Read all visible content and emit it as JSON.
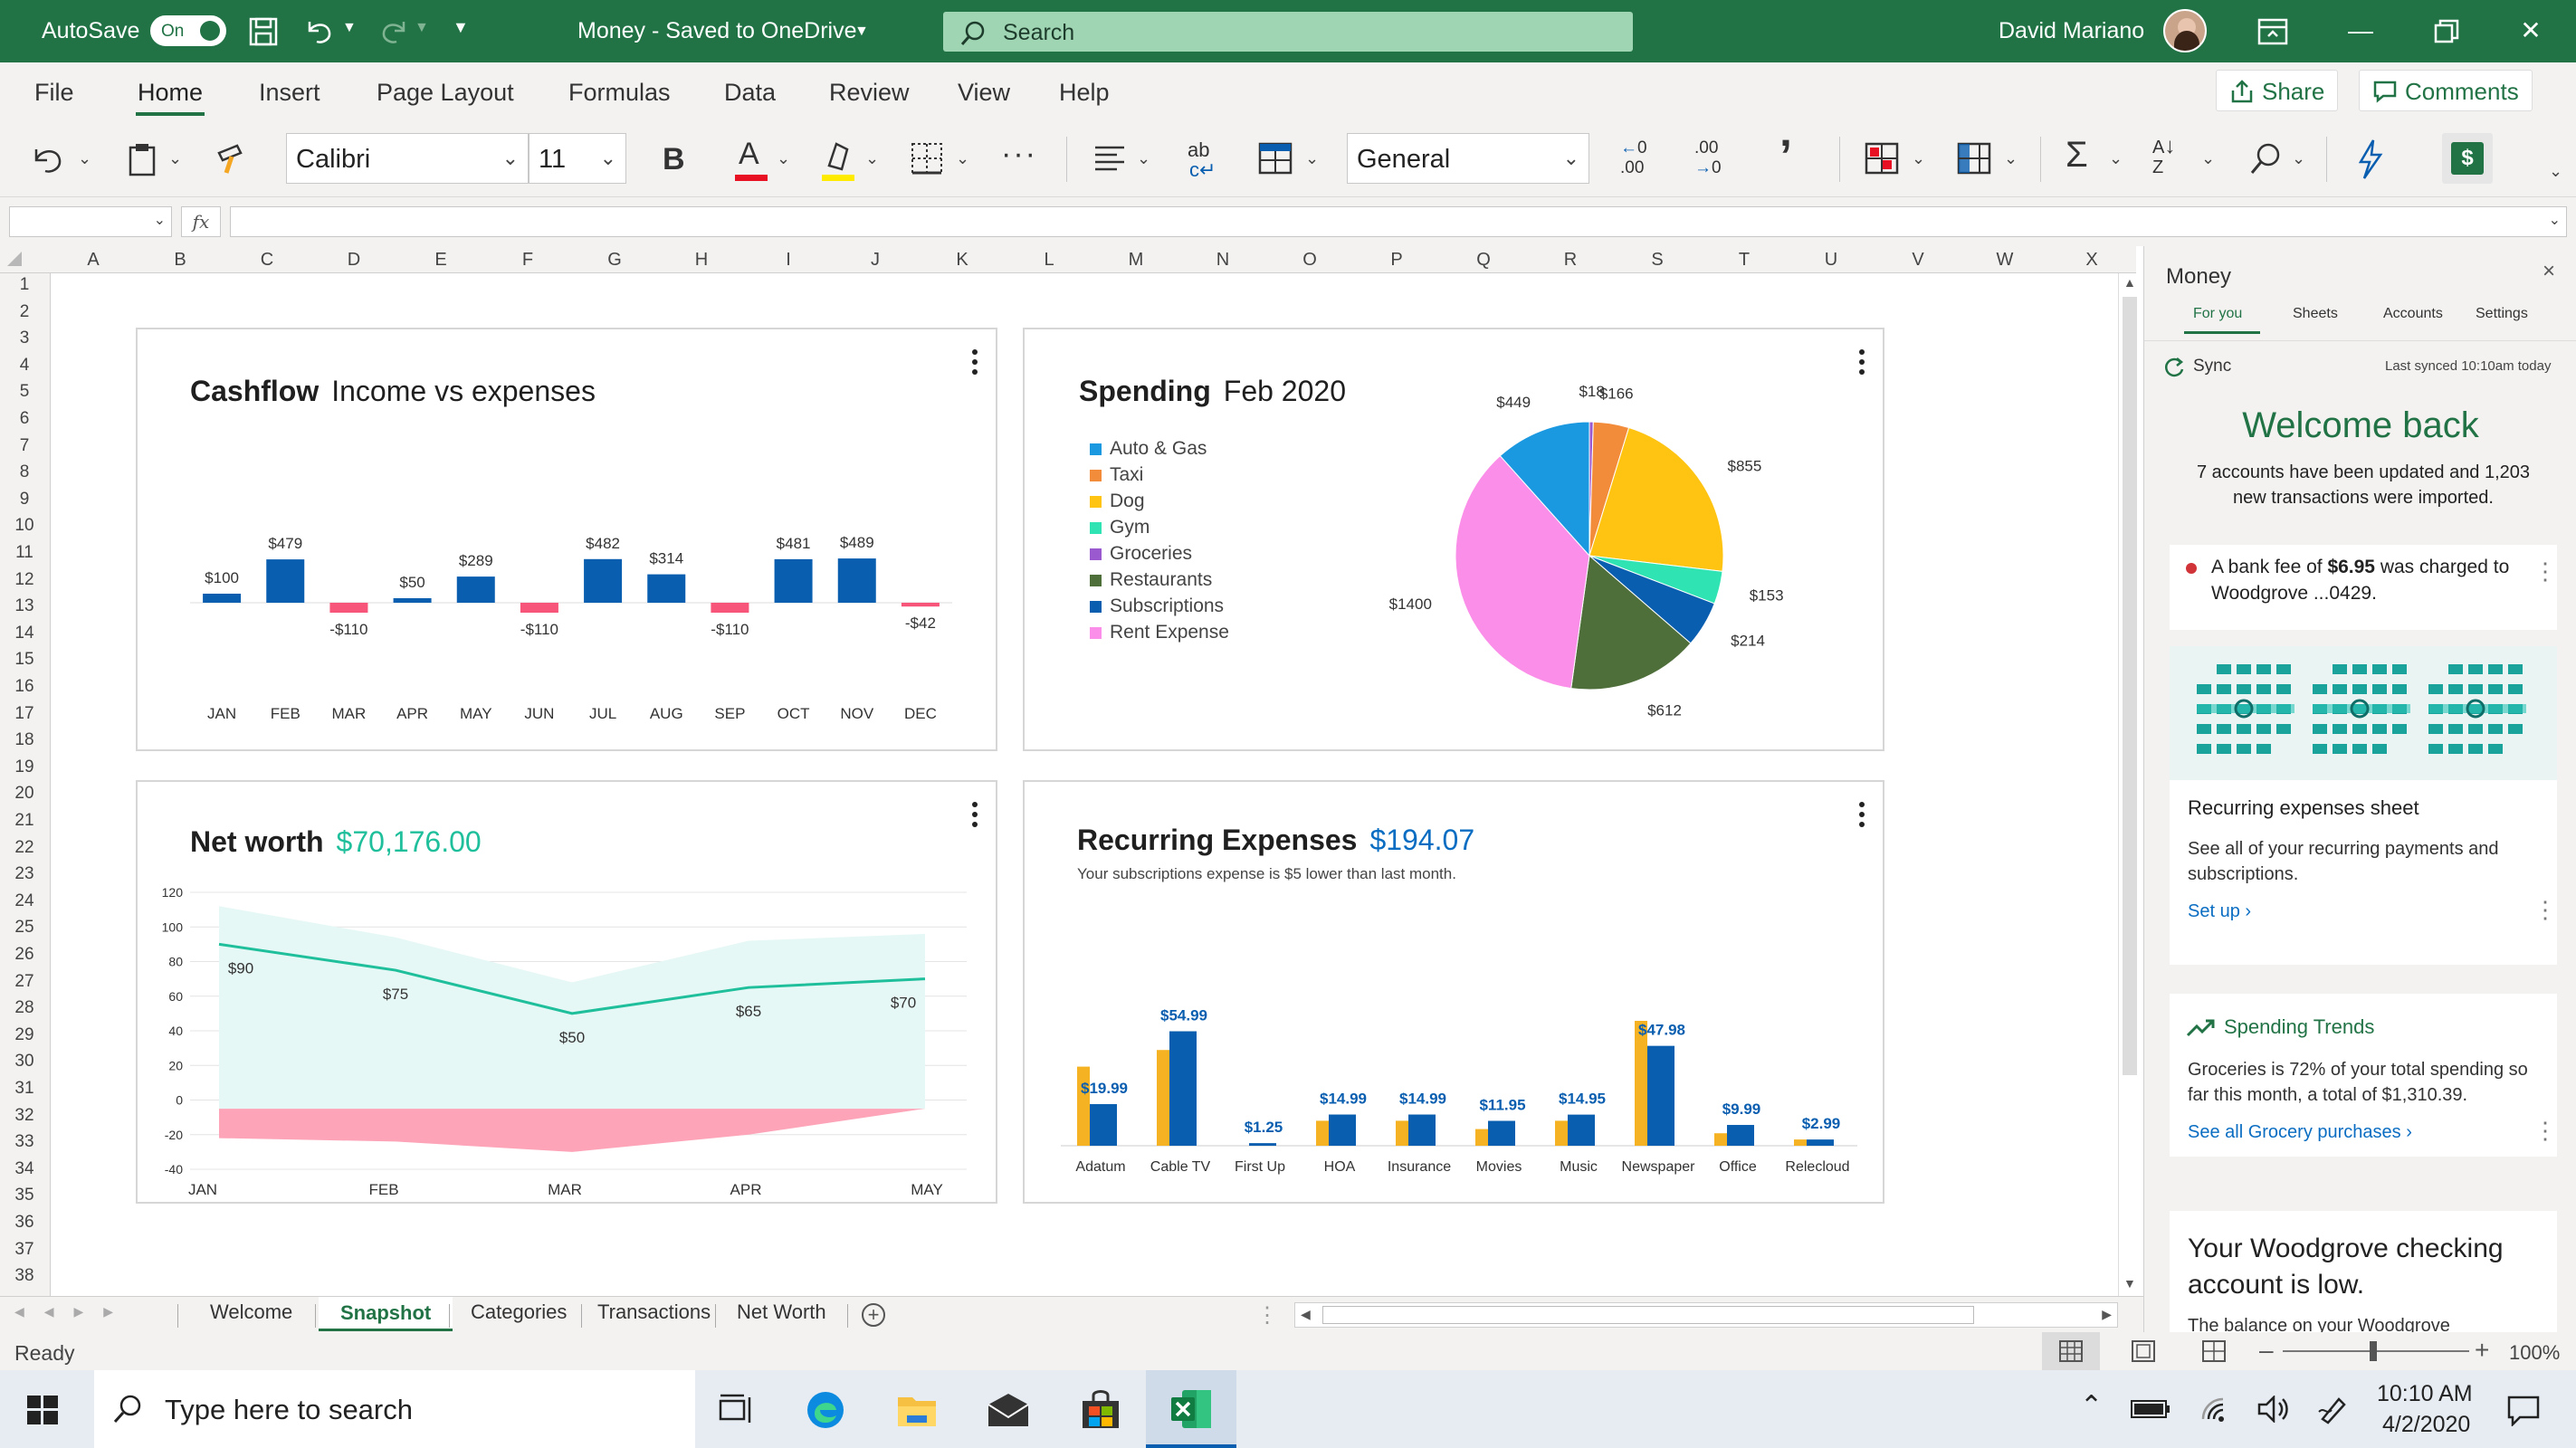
{
  "titlebar": {
    "autosave_label": "AutoSave",
    "autosave_state": "On",
    "doc_title": "Money - Saved to OneDrive",
    "search_placeholder": "Search",
    "user_name": "David Mariano"
  },
  "menu": {
    "items": [
      "File",
      "Home",
      "Insert",
      "Page Layout",
      "Formulas",
      "Data",
      "Review",
      "View",
      "Help"
    ],
    "active": "Home",
    "share_label": "Share",
    "comments_label": "Comments"
  },
  "ribbon": {
    "font_name": "Calibri",
    "font_size": "11",
    "number_format": "General",
    "font_color": "#e81123",
    "highlight_color": "#ffeb00"
  },
  "grid": {
    "columns": [
      "A",
      "B",
      "C",
      "D",
      "E",
      "F",
      "G",
      "H",
      "I",
      "J",
      "K",
      "L",
      "M",
      "N",
      "O",
      "P",
      "Q",
      "R",
      "S",
      "T",
      "U",
      "V",
      "W",
      "X"
    ],
    "rows": [
      "1",
      "2",
      "3",
      "4",
      "5",
      "6",
      "7",
      "8",
      "9",
      "10",
      "11",
      "12",
      "13",
      "14",
      "15",
      "16",
      "17",
      "18",
      "19",
      "20",
      "21",
      "22",
      "23",
      "24",
      "25",
      "26",
      "27",
      "28",
      "29",
      "30",
      "31",
      "32",
      "33",
      "34",
      "35",
      "36",
      "37",
      "38"
    ]
  },
  "cards": {
    "cashflow": {
      "title": "Cashflow",
      "subtitle": "Income vs expenses"
    },
    "spending": {
      "title": "Spending",
      "subtitle": "Feb 2020"
    },
    "networth": {
      "title": "Net worth",
      "subtitle": "$70,176.00"
    },
    "recurring": {
      "title": "Recurring Expenses",
      "subtitle": "$194.07",
      "note": "Your subscriptions expense is $5 lower than last month."
    }
  },
  "chart_data": [
    {
      "type": "bar",
      "title": "Cashflow",
      "categories": [
        "JAN",
        "FEB",
        "MAR",
        "APR",
        "MAY",
        "JUN",
        "JUL",
        "AUG",
        "SEP",
        "OCT",
        "NOV",
        "DEC"
      ],
      "values": [
        100,
        479,
        -110,
        50,
        289,
        -110,
        482,
        314,
        -110,
        481,
        489,
        -42
      ],
      "labels": [
        "$100",
        "$479",
        "-$110",
        "$50",
        "$289",
        "-$110",
        "$482",
        "$314",
        "-$110",
        "$481",
        "$489",
        "-$42"
      ],
      "colors": {
        "positive": "#0a5eb0",
        "negative": "#f7557a"
      }
    },
    {
      "type": "pie",
      "title": "Spending",
      "categories": [
        "Auto & Gas",
        "Taxi",
        "Dog",
        "Gym",
        "Groceries",
        "Restaurants",
        "Subscriptions",
        "Rent Expense"
      ],
      "values": [
        449,
        18,
        166,
        855,
        153,
        214,
        612,
        1400
      ],
      "slice_labels": [
        "$18",
        "$166",
        "$855",
        "$153",
        "$214",
        "$612",
        "$1400",
        "$449"
      ],
      "slice_order": [
        "Groceries",
        "Taxi",
        "Dog",
        "Gym",
        "Subscriptions",
        "Restaurants",
        "Rent Expense",
        "Auto & Gas"
      ],
      "slice_values": [
        18,
        166,
        855,
        153,
        214,
        612,
        1400,
        449
      ],
      "colors": [
        "#1a98e0",
        "#f28c3b",
        "#ffc312",
        "#2fe3b3",
        "#9b59d0",
        "#4f6f3a",
        "#0a5eb0",
        "#fb8ee8"
      ],
      "slice_colors": [
        "#9b59d0",
        "#f28c3b",
        "#ffc312",
        "#2fe3b3",
        "#0a5eb0",
        "#4f6f3a",
        "#fb8ee8",
        "#1a98e0"
      ]
    },
    {
      "type": "area",
      "title": "Net worth",
      "categories": [
        "JAN",
        "FEB",
        "MAR",
        "APR",
        "MAY"
      ],
      "series": [
        {
          "values": [
            90,
            75,
            50,
            65,
            70
          ]
        }
      ],
      "point_labels": [
        "$90",
        "$75",
        "$50",
        "$65",
        "$70"
      ],
      "upper_band": [
        112,
        94,
        68,
        92,
        96
      ],
      "lower_band": [
        -5,
        -5,
        -5,
        -5,
        -5
      ],
      "negative_band_top": [
        -5,
        -5,
        -5,
        -5,
        -5
      ],
      "negative_band_bottom": [
        -22,
        -24,
        -30,
        -20,
        -5
      ],
      "yticks": [
        120,
        100,
        80,
        60,
        40,
        20,
        0,
        -20,
        -40
      ],
      "ylim": [
        -40,
        120
      ]
    },
    {
      "type": "bar",
      "title": "Recurring Expenses",
      "categories": [
        "Adatum",
        "Cable TV",
        "First Up",
        "HOA",
        "Insurance",
        "Movies",
        "Music",
        "Newspaper",
        "Office",
        "Relecloud"
      ],
      "series": [
        {
          "values": [
            38,
            46,
            0,
            12,
            12,
            8,
            12,
            60,
            6,
            3
          ]
        },
        {
          "values": [
            19.99,
            54.99,
            1.25,
            14.99,
            14.99,
            11.95,
            14.95,
            47.98,
            9.99,
            2.99
          ]
        }
      ],
      "labels": [
        "$19.99",
        "$54.99",
        "$1.25",
        "$14.99",
        "$14.99",
        "$11.95",
        "$14.95",
        "$47.98",
        "$9.99",
        "$2.99"
      ],
      "colors": [
        "#f5b324",
        "#0a5eb0"
      ]
    }
  ],
  "sheets": {
    "tabs": [
      "Welcome",
      "Snapshot",
      "Categories",
      "Transactions",
      "Net Worth"
    ],
    "active": "Snapshot"
  },
  "status": {
    "ready": "Ready",
    "zoom": "100%"
  },
  "panel": {
    "title": "Money",
    "tabs": [
      "For you",
      "Sheets",
      "Accounts",
      "Settings"
    ],
    "active_tab": "For you",
    "sync_label": "Sync",
    "last_synced": "Last synced 10:10am today",
    "welcome_title": "Welcome back",
    "welcome_text": "7 accounts have been updated and 1,203 new transactions were imported.",
    "alert_prefix": "A bank fee of ",
    "alert_amount": "$6.95",
    "alert_suffix": " was charged to Woodgrove ...0429.",
    "recurring_title": "Recurring expenses sheet",
    "recurring_text": "See all of your recurring payments and subscriptions.",
    "recurring_link": "Set up ›",
    "trends_title": "Spending Trends",
    "trends_text": "Groceries is 72% of your total spending so far this month, a total of $1,310.39.",
    "trends_link": "See all Grocery purchases ›",
    "low_title": "Your Woodgrove checking account is low.",
    "low_text": "The balance on your Woodgrove"
  },
  "taskbar": {
    "search_placeholder": "Type here to search",
    "time": "10:10 AM",
    "date": "4/2/2020"
  }
}
